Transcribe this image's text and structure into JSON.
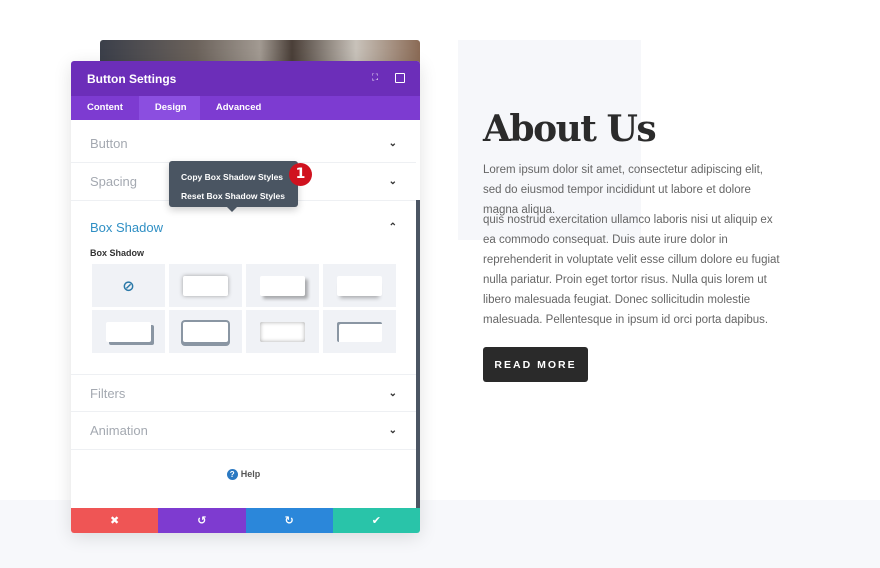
{
  "page": {
    "title": "About Us",
    "paragraph1": "Lorem ipsum dolor sit amet, consectetur adipiscing elit, sed do eiusmod tempor incididunt ut labore et dolore magna aliqua.",
    "paragraph2": "quis nostrud exercitation ullamco laboris nisi ut aliquip ex ea commodo consequat. Duis aute irure dolor in reprehenderit in voluptate velit esse cillum dolore eu fugiat nulla pariatur. Proin eget tortor risus. Nulla quis lorem ut libero malesuada feugiat. Donec sollicitudin molestie malesuada. Pellentesque in ipsum id orci porta dapibus.",
    "button": "READ MORE"
  },
  "panel": {
    "title": "Button Settings",
    "tabs": [
      {
        "label": "Content"
      },
      {
        "label": "Design"
      },
      {
        "label": "Advanced"
      }
    ],
    "active_tab": "Design",
    "sections": {
      "button": "Button",
      "spacing": "Spacing",
      "box_shadow": "Box Shadow",
      "filters": "Filters",
      "animation": "Animation"
    },
    "box_shadow_label": "Box Shadow",
    "help": "Help",
    "footer_colors": {
      "cancel": "#ef5555",
      "undo": "#7e3bd0",
      "redo": "#2b87da",
      "save": "#29c4a9"
    }
  },
  "tooltip": {
    "items": [
      "Copy Box Shadow Styles",
      "Reset Box Shadow Styles"
    ]
  },
  "badge": "1",
  "colors": {
    "header": "#6c2eb9",
    "tabs": "#7d3bd1",
    "accent": "#2f8fc4"
  }
}
